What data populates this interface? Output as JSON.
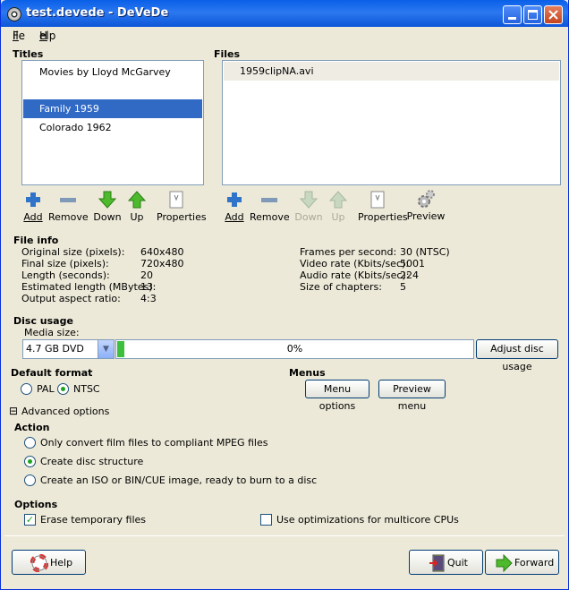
{
  "window": {
    "title": "test.devede - DeVeDe"
  },
  "menu": {
    "file": "File",
    "help": "Help"
  },
  "titles": {
    "heading": "Titles",
    "items": [
      "Movies by Lloyd McGarvey",
      "Family 1959",
      "Colorado 1962"
    ],
    "selected": "Family 1959"
  },
  "files": {
    "heading": "Files",
    "items": [
      "1959clipNA.avi"
    ]
  },
  "title_toolbar": {
    "add": "Add",
    "remove": "Remove",
    "down": "Down",
    "up": "Up",
    "properties": "Properties"
  },
  "file_toolbar": {
    "add": "Add",
    "remove": "Remove",
    "down": "Down",
    "up": "Up",
    "properties": "Properties",
    "preview": "Preview"
  },
  "file_info": {
    "heading": "File info",
    "left": [
      {
        "label": "Original size (pixels):",
        "value": "640x480"
      },
      {
        "label": "Final size (pixels):",
        "value": "720x480"
      },
      {
        "label": "Length (seconds):",
        "value": "20"
      },
      {
        "label": "Estimated length (MBytes):",
        "value": "13"
      },
      {
        "label": "Output aspect ratio:",
        "value": "4:3"
      }
    ],
    "right": [
      {
        "label": "Frames per second:",
        "value": "30 (NTSC)"
      },
      {
        "label": "Video rate (Kbits/sec):",
        "value": "5001"
      },
      {
        "label": "Audio rate (Kbits/sec):",
        "value": "224"
      },
      {
        "label": "Size of chapters:",
        "value": "5"
      }
    ]
  },
  "disc_usage": {
    "heading": "Disc usage",
    "media_label": "Media size:",
    "media_value": "4.7 GB DVD",
    "usage_text": "0%",
    "usage_fraction": 0.005,
    "adjust_button": "Adjust disc usage"
  },
  "default_format": {
    "heading": "Default format",
    "pal": "PAL",
    "ntsc": "NTSC",
    "selected": "NTSC"
  },
  "menus": {
    "heading": "Menus",
    "menu_options": "Menu options",
    "preview_menu": "Preview menu"
  },
  "advanced": {
    "label": "Advanced options",
    "expander": "⊟"
  },
  "action": {
    "heading": "Action",
    "options": [
      "Only convert film files to compliant MPEG files",
      "Create disc structure",
      "Create an ISO or BIN/CUE image, ready to burn to a disc"
    ],
    "selected": "Create disc structure"
  },
  "options": {
    "heading": "Options",
    "erase": "Erase temporary files",
    "erase_checked": true,
    "multicore": "Use optimizations for multicore CPUs",
    "multicore_checked": false
  },
  "footer": {
    "help": "Help",
    "quit": "Quit",
    "forward": "Forward"
  },
  "colors": {
    "titlebar": "#0a5fe8",
    "selection": "#316ac5",
    "background": "#ece9d8"
  }
}
